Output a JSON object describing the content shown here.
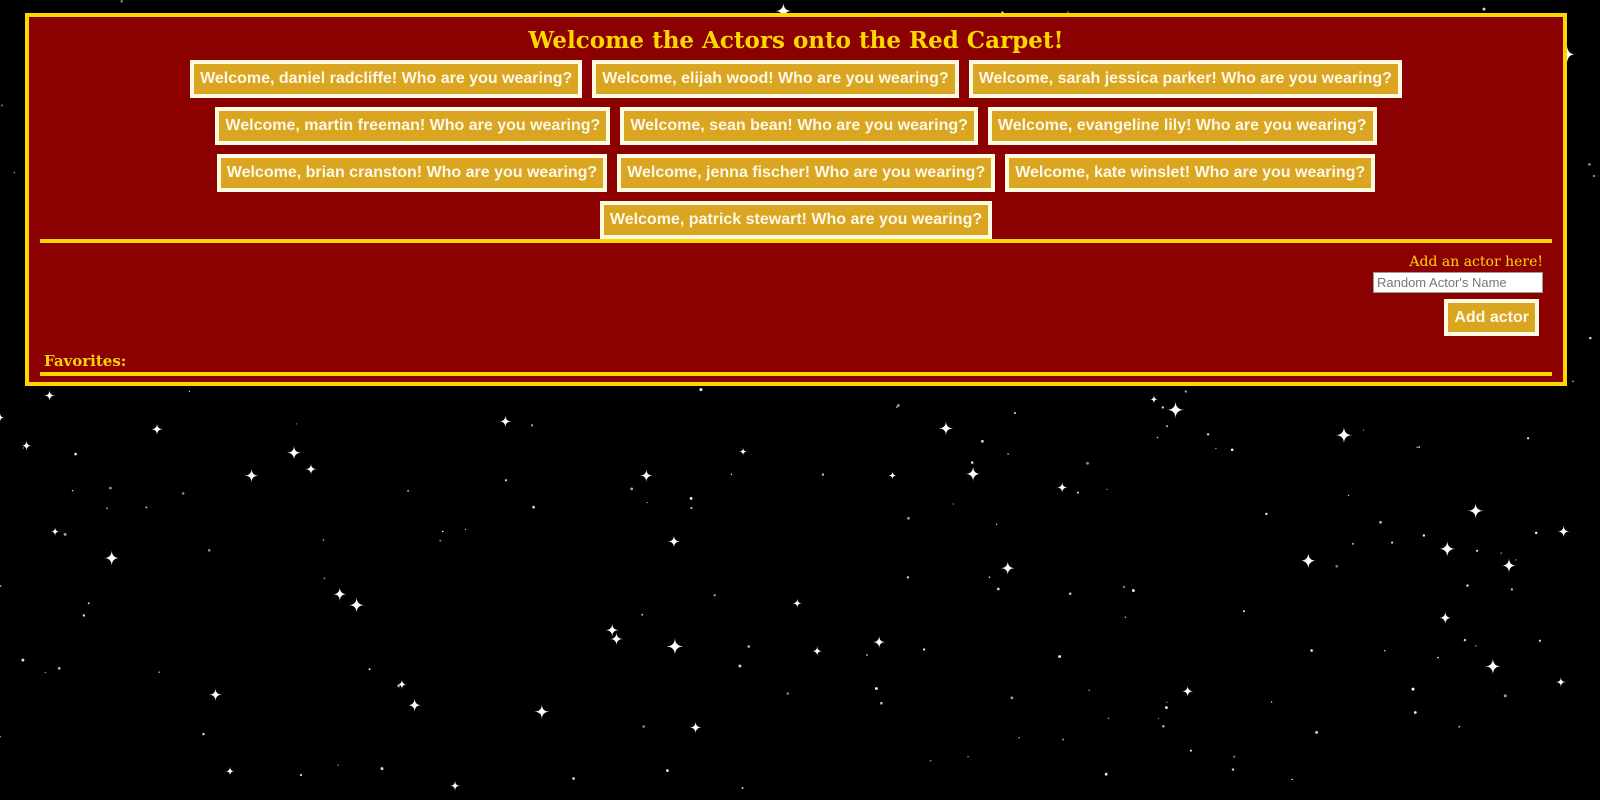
{
  "page": {
    "title": "Welcome the Actors onto the Red Carpet!"
  },
  "actors": [
    [
      "Welcome, daniel radcliffe! Who are you wearing?",
      "Welcome, elijah wood! Who are you wearing?",
      "Welcome, sarah jessica parker! Who are you wearing?"
    ],
    [
      "Welcome, martin freeman! Who are you wearing?",
      "Welcome, sean bean! Who are you wearing?",
      "Welcome, evangeline lily! Who are you wearing?"
    ],
    [
      "Welcome, brian cranston! Who are you wearing?",
      "Welcome, jenna fischer! Who are you wearing?",
      "Welcome, kate winslet! Who are you wearing?"
    ],
    [
      "Welcome, patrick stewart! Who are you wearing?"
    ]
  ],
  "add_form": {
    "label": "Add an actor here!",
    "input_placeholder": "Random Actor's Name",
    "input_value": "",
    "button_label": "Add actor"
  },
  "favorites": {
    "label": "Favorites:"
  },
  "colors": {
    "background": "#000000",
    "panel": "#8b0000",
    "accent": "#ffd700",
    "button": "#daa520",
    "button_text": "#fff8e7"
  },
  "background_icon": "starfield"
}
